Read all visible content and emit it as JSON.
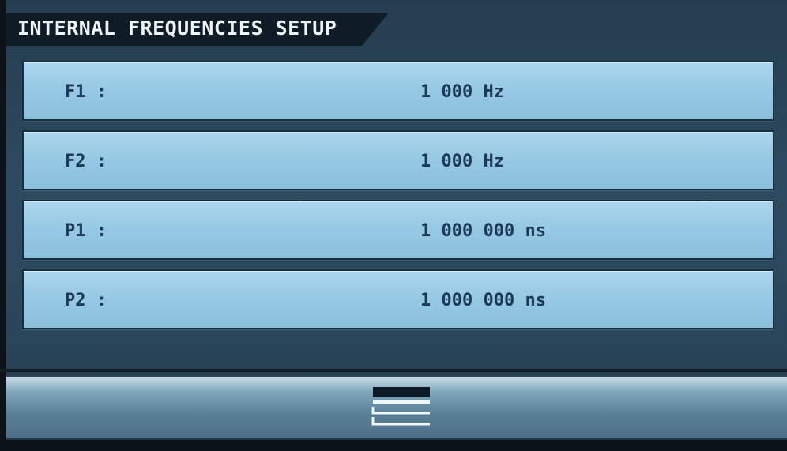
{
  "header": {
    "title": "INTERNAL FREQUENCIES SETUP"
  },
  "settings": [
    {
      "label": "F1 :",
      "value": "1 000 Hz"
    },
    {
      "label": "F2 :",
      "value": "1 000 Hz"
    },
    {
      "label": "P1 :",
      "value": "1 000 000 ns"
    },
    {
      "label": "P2 :",
      "value": "1 000 000 ns"
    }
  ],
  "footer": {
    "menu_icon": "menu-icon"
  },
  "colors": {
    "row_background": "#9fcfe8",
    "row_text": "#1d3a58",
    "title_text": "#eef4f8",
    "title_background": "#0f1c26",
    "screen_background": "#2c4a60"
  }
}
